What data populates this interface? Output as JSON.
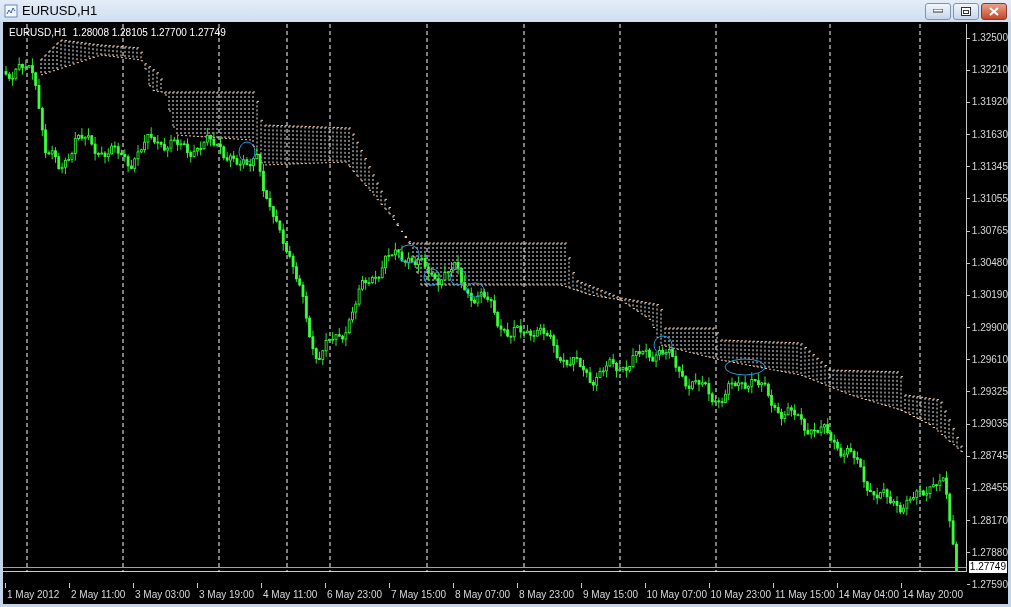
{
  "window": {
    "title": "EURUSD,H1"
  },
  "chart": {
    "symbol": "EURUSD,H1",
    "ohlc": "1.28008 1.28105 1.27700 1.27749",
    "price_axis": [
      "1.32500",
      "1.32210",
      "1.31920",
      "1.31630",
      "1.31345",
      "1.31055",
      "1.30765",
      "1.30480",
      "1.30190",
      "1.29900",
      "1.29610",
      "1.29325",
      "1.29035",
      "1.28745",
      "1.28455",
      "1.28170",
      "1.27880",
      "1.27590"
    ],
    "current_price": "1.27749",
    "time_axis": [
      "1 May 2012",
      "2 May 11:00",
      "3 May 03:00",
      "3 May 19:00",
      "4 May 11:00",
      "6 May 23:00",
      "7 May 15:00",
      "8 May 07:00",
      "8 May 23:00",
      "9 May 15:00",
      "10 May 07:00",
      "10 May 23:00",
      "11 May 15:00",
      "14 May 04:00",
      "14 May 20:00"
    ]
  }
}
